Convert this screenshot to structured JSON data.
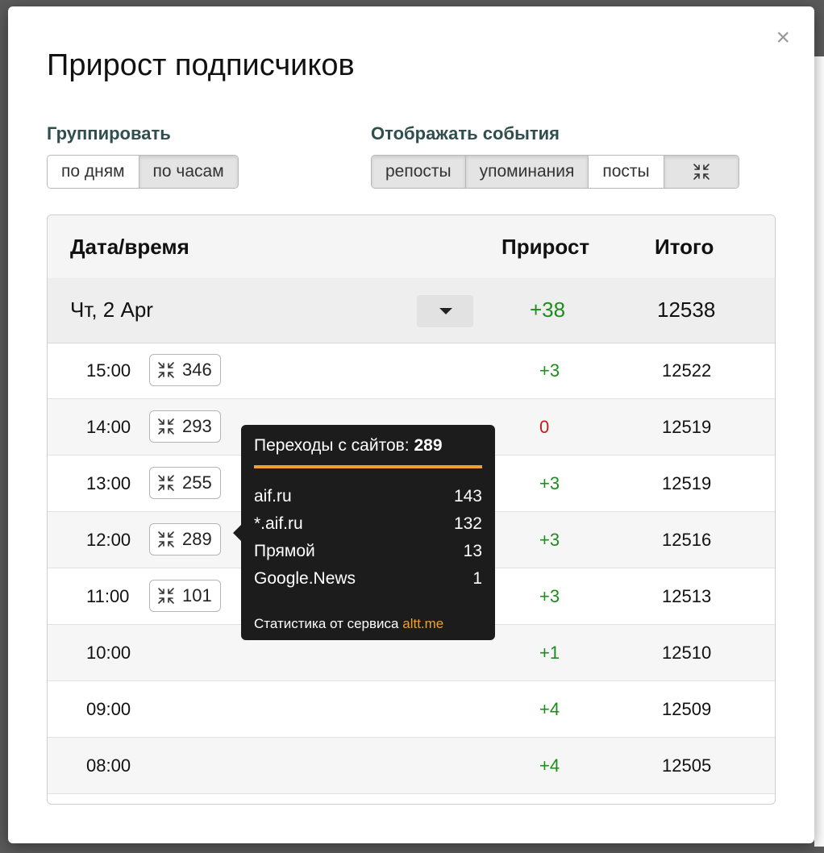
{
  "background": {
    "behind_letter": "2"
  },
  "modal": {
    "title": "Прирост подписчиков",
    "close_glyph": "×"
  },
  "grouping": {
    "label": "Группировать",
    "options": [
      {
        "label": "по дням",
        "active": false
      },
      {
        "label": "по часам",
        "active": true
      }
    ]
  },
  "events": {
    "label": "Отображать события",
    "options": [
      {
        "label": "репосты",
        "active": true
      },
      {
        "label": "упоминания",
        "active": true
      },
      {
        "label": "посты",
        "active": false
      },
      {
        "icon": "referral-arrows-icon",
        "active": true
      }
    ]
  },
  "table": {
    "headers": {
      "datetime": "Дата/время",
      "growth": "Прирост",
      "total": "Итого"
    },
    "day": {
      "label": "Чт, 2 Apr",
      "growth": "+38",
      "total": "12538"
    },
    "rows": [
      {
        "time": "15:00",
        "referrals": "346",
        "growth": "+3",
        "total": "12522"
      },
      {
        "time": "14:00",
        "referrals": "293",
        "growth": "0",
        "total": "12519"
      },
      {
        "time": "13:00",
        "referrals": "255",
        "growth": "+3",
        "total": "12519"
      },
      {
        "time": "12:00",
        "referrals": "289",
        "growth": "+3",
        "total": "12516"
      },
      {
        "time": "11:00",
        "referrals": "101",
        "growth": "+3",
        "total": "12513"
      },
      {
        "time": "10:00",
        "referrals": "",
        "growth": "+1",
        "total": "12510"
      },
      {
        "time": "09:00",
        "referrals": "",
        "growth": "+4",
        "total": "12509"
      },
      {
        "time": "08:00",
        "referrals": "",
        "growth": "+4",
        "total": "12505"
      }
    ]
  },
  "tooltip": {
    "title": "Переходы с сайтов:",
    "count": "289",
    "items": [
      {
        "site": "aif.ru",
        "value": "143"
      },
      {
        "site": "*.aif.ru",
        "value": "132"
      },
      {
        "site": "Прямой",
        "value": "13"
      },
      {
        "site": "Google.News",
        "value": "1"
      }
    ],
    "footer_text": "Статистика от сервиса",
    "footer_link": "altt.me"
  },
  "colors": {
    "positive": "#1e8c1e",
    "zero": "#c51a1a",
    "accent": "#f0a030"
  }
}
